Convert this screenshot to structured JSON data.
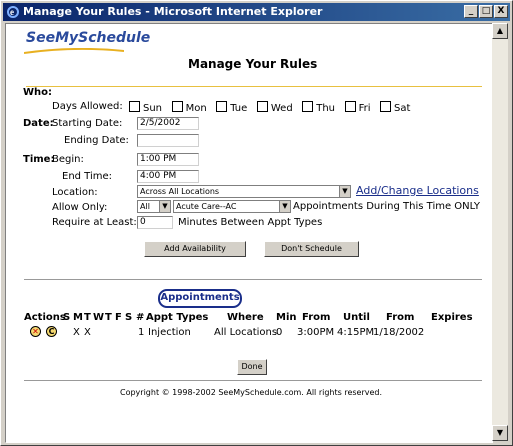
{
  "window": {
    "title": "Manage Your Rules - Microsoft Internet Explorer",
    "min": "_",
    "max": "□",
    "close": "X"
  },
  "logo": "SeeMySchedule",
  "page_title": "Manage Your Rules",
  "who": {
    "label": "Who:",
    "days_label": "Days Allowed:",
    "days": [
      "Sun",
      "Mon",
      "Tue",
      "Wed",
      "Thu",
      "Fri",
      "Sat"
    ]
  },
  "date": {
    "label": "Date:",
    "start_label": "Starting Date:",
    "start_value": "2/5/2002",
    "end_label": "Ending Date:",
    "end_value": ""
  },
  "time": {
    "label": "Time:",
    "begin_label": "Begin:",
    "begin_value": "1:00 PM",
    "end_label": "End Time:",
    "end_value": "4:00 PM"
  },
  "location": {
    "label": "Location:",
    "value": "Across All Locations",
    "link": "Add/Change Locations"
  },
  "allow": {
    "label": "Allow Only:",
    "qty": "All",
    "type": "Acute Care--AC",
    "suffix": "Appointments During This Time ONLY"
  },
  "require": {
    "label": "Require at Least:",
    "value": "0",
    "suffix": "Minutes Between Appt Types"
  },
  "buttons": {
    "add": "Add Availability",
    "dont": "Don't Schedule",
    "done": "Done"
  },
  "appointments": {
    "tab": "Appointments",
    "headers": [
      "Actions",
      "S",
      "M",
      "T",
      "W",
      "T",
      "F",
      "S",
      "#",
      "Appt Types",
      "Where",
      "Min",
      "From",
      "Until",
      "From",
      "Expires"
    ],
    "rows": [
      {
        "s": "",
        "m": "X",
        "t": "X",
        "num": "1",
        "type": "Injection",
        "where": "All Locations",
        "min": "0",
        "from": "3:00PM",
        "until": "4:15PM",
        "from_date": "1/18/2002",
        "expires": ""
      }
    ]
  },
  "footer": "Copyright © 1998-2002  SeeMySchedule.com.   All rights reserved."
}
